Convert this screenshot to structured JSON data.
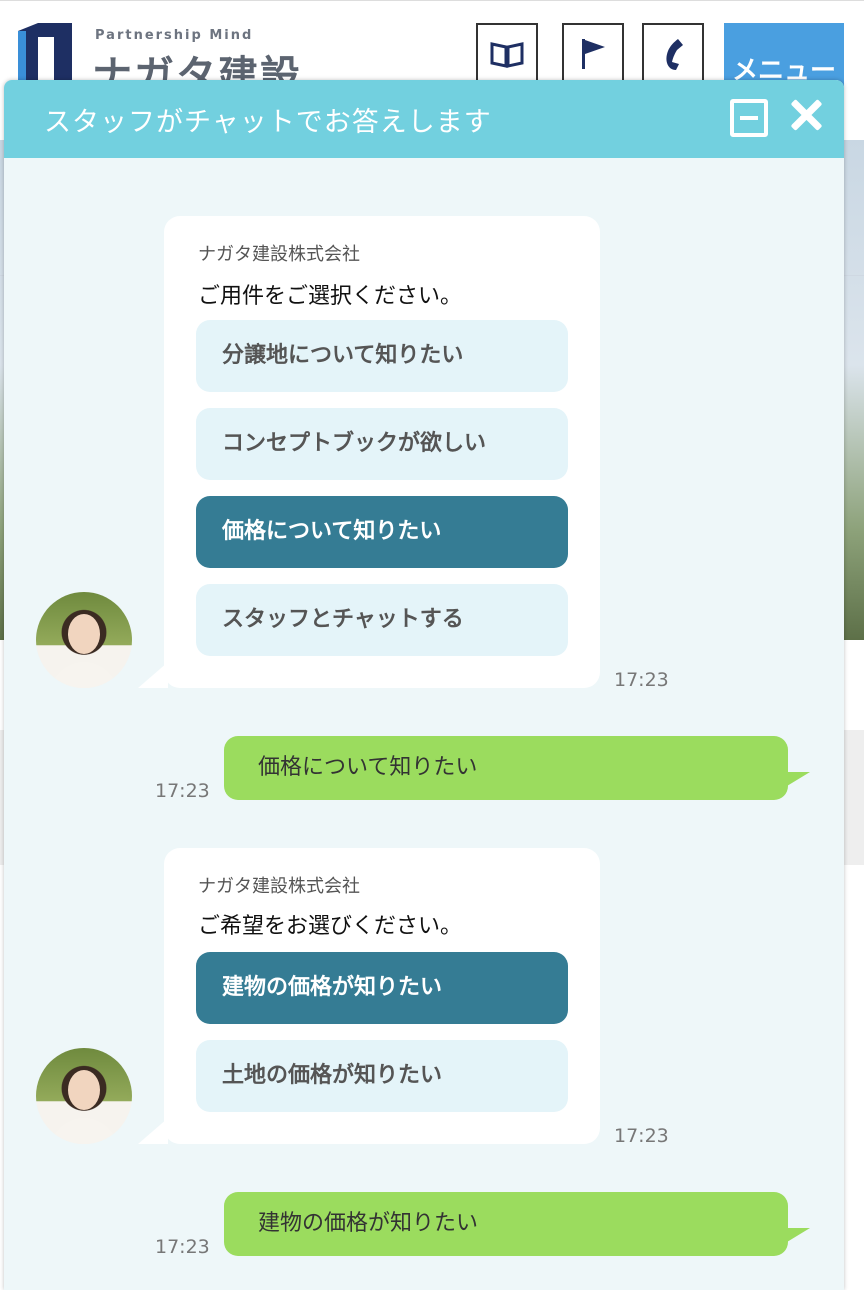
{
  "site": {
    "logo_tagline": "Partnership Mind",
    "logo_name": "ナガタ建設",
    "menu_label": "メニュー",
    "icons": [
      "book-icon",
      "flag-icon",
      "phone-icon"
    ]
  },
  "chat": {
    "title": "スタッフがチャットでお答えします",
    "icons": [
      "minimize-icon",
      "close-icon"
    ],
    "colors": {
      "header": "#72d0df",
      "selected_option": "#357c94",
      "user_bubble": "#9bdc5e",
      "background": "#eef7f9"
    },
    "messages": [
      {
        "sender": "ナガタ建設株式会社",
        "prompt": "ご用件をご選択ください。",
        "options": [
          "分譲地について知りたい",
          "コンセプトブックが欲しい",
          "価格について知りたい",
          "スタッフとチャットする"
        ],
        "selected": "価格について知りたい",
        "time": "17:23"
      },
      {
        "user_text": "価格について知りたい",
        "time": "17:23"
      },
      {
        "sender": "ナガタ建設株式会社",
        "prompt": "ご希望をお選びください。",
        "options": [
          "建物の価格が知りたい",
          "土地の価格が知りたい"
        ],
        "selected": "建物の価格が知りたい",
        "time": "17:23"
      },
      {
        "user_text": "建物の価格が知りたい",
        "time": "17:23"
      }
    ]
  }
}
